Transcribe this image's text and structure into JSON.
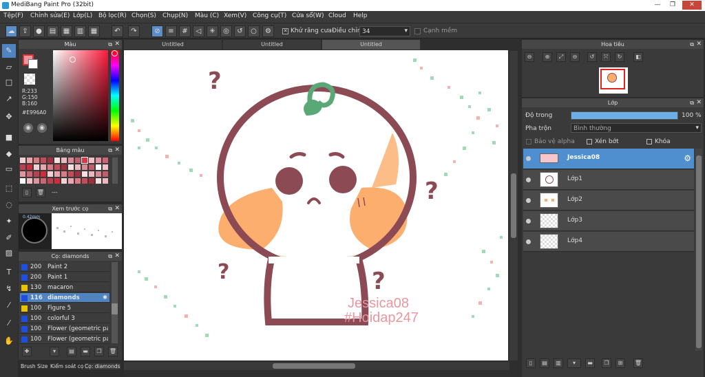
{
  "window": {
    "title": "MediBang Paint Pro (32bit)"
  },
  "menu": [
    "Tệp(F)",
    "Chỉnh sửa(E)",
    "Lớp(L)",
    "Bộ lọc(R)",
    "Chọn(S)",
    "Chụp(N)",
    "Màu (C)",
    "Xem(V)",
    "Công cụ(T)",
    "Cửa sổ(W)",
    "Cloud",
    "Help"
  ],
  "toolbar": {
    "antialias_label": "Khử răng cưa",
    "correction_label": "Điều chỉnh",
    "correction_value": "34",
    "snap_label": "Cạnh mềm"
  },
  "color_panel": {
    "title": "Màu",
    "r": "R:233",
    "g": "G:150",
    "b": "B:160",
    "hex": "#E996A0",
    "primary": "#e996a0"
  },
  "palette_panel": {
    "title": "Bảng màu",
    "footer": "---"
  },
  "brush_preview": {
    "title": "Xem trước cọ",
    "size_label": "0.42mm"
  },
  "brush_panel": {
    "title": "Cọ: diamonds",
    "items": [
      {
        "size": "200",
        "name": "Paint 2",
        "color": "#1f4fe0"
      },
      {
        "size": "200",
        "name": "Paint 1",
        "color": "#1f4fe0"
      },
      {
        "size": "130",
        "name": "macaron",
        "color": "#e8c400"
      },
      {
        "size": "116",
        "name": "diamonds",
        "color": "#1f4fe0",
        "selected": true
      },
      {
        "size": "100",
        "name": "Figure 5",
        "color": "#e8c400"
      },
      {
        "size": "100",
        "name": "colorful 3",
        "color": "#1f4fe0"
      },
      {
        "size": "100",
        "name": "Flower (geometric pat",
        "color": "#1f4fe0"
      },
      {
        "size": "100",
        "name": "Flower (geometric pat",
        "color": "#1f4fe0"
      }
    ]
  },
  "bottom_tabs": [
    "Brush Size",
    "Kiểm soát cọ",
    "Cọ: diamonds"
  ],
  "doc_tabs": [
    "Untitled",
    "Untitled",
    "Untitled"
  ],
  "canvas": {
    "watermark1": "Jessica08",
    "watermark2": "#Hoidap247",
    "question_mark": "?"
  },
  "navigator": {
    "title": "Hoa tiêu"
  },
  "layer_panel": {
    "title": "Lớp",
    "opacity_label": "Độ trong",
    "opacity_value": "100 %",
    "opacity_fraction": 1.0,
    "blend_label": "Pha trộn",
    "blend_value": "Bình thường",
    "protect_alpha": "Bảo vệ alpha",
    "clip": "Xén bớt",
    "lock": "Khóa",
    "layers": [
      {
        "name": "Jessica08",
        "selected": true
      },
      {
        "name": "Lớp1"
      },
      {
        "name": "Lớp2"
      },
      {
        "name": "Lớp3"
      },
      {
        "name": "Lớp4"
      }
    ]
  }
}
